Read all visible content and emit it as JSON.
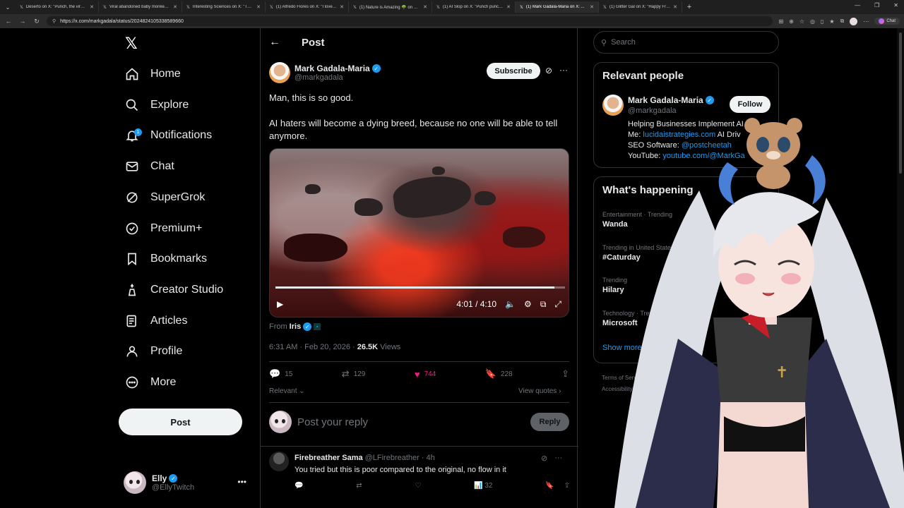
{
  "browser": {
    "tabs": [
      {
        "title": "Deserto on X: \"Punch, the viral toy...",
        "active": false
      },
      {
        "title": "Viral abandoned baby monkey tak...",
        "active": false
      },
      {
        "title": "Interesting Sciences on X: \"The sh...",
        "active": false
      },
      {
        "title": "(1) Alfredo Flores on X: \"I love pu...",
        "active": false
      },
      {
        "title": "(1) Nature is Amazing 🌳 on X: \"P...",
        "active": false
      },
      {
        "title": "(1) AI Slop on X: \"Punch punches t...",
        "active": false
      },
      {
        "title": "(1) Mark Gadala-Maria on X: ...",
        "active": true
      },
      {
        "title": "(1) Glitter Gal on X: \"Happy Friday...",
        "active": false
      }
    ],
    "url": "https://x.com/markgadala/status/2024824105338589660",
    "chat_label": "Chat"
  },
  "nav": {
    "items": [
      {
        "label": "Home",
        "icon": "home-icon"
      },
      {
        "label": "Explore",
        "icon": "search-icon"
      },
      {
        "label": "Notifications",
        "icon": "bell-icon"
      },
      {
        "label": "Chat",
        "icon": "mail-icon"
      },
      {
        "label": "SuperGrok",
        "icon": "grok-icon"
      },
      {
        "label": "Premium+",
        "icon": "premium-icon"
      },
      {
        "label": "Bookmarks",
        "icon": "bookmark-icon"
      },
      {
        "label": "Creator Studio",
        "icon": "creator-icon"
      },
      {
        "label": "Articles",
        "icon": "article-icon"
      },
      {
        "label": "Profile",
        "icon": "profile-icon"
      },
      {
        "label": "More",
        "icon": "more-circle-icon"
      }
    ],
    "notification_count": "1",
    "post_label": "Post",
    "account": {
      "name": "Elly",
      "handle": "@EllyTwitch"
    }
  },
  "post": {
    "header_title": "Post",
    "author_name": "Mark Gadala-Maria",
    "author_handle": "@markgadala",
    "subscribe_label": "Subscribe",
    "text1": "Man, this is so good.",
    "text2": "AI haters will become a dying breed, because no one will be able to tell anymore.",
    "video": {
      "time": "4:01 / 4:10",
      "progress": 0.964
    },
    "from_label": "From",
    "from_name": "Iris",
    "timestamp": "6:31 AM · Feb 20, 2026 · ",
    "views_count": "26.5K",
    "views_label": " Views",
    "replies": "15",
    "reposts": "129",
    "likes": "744",
    "bookmarks": "228",
    "relevant_label": "Relevant",
    "view_quotes_label": "View quotes",
    "reply_placeholder": "Post your reply",
    "reply_button": "Reply"
  },
  "reply": {
    "name": "Firebreather Sama",
    "handle": "@LFirebreather",
    "time": "· 4h",
    "text": "You tried but this is poor compared to the original, no flow in it",
    "views": "32"
  },
  "sidebar": {
    "search_placeholder": "Search",
    "relevant_title": "Relevant people",
    "person": {
      "name": "Mark Gadala-Maria",
      "handle": "@markgadala",
      "follow_label": "Follow",
      "bio_line1": "Helping Businesses Implement AI",
      "bio_line2_prefix": "Me: ",
      "bio_line2_link": "lucidaistrategies.com",
      "bio_line2_suffix": " AI Driv",
      "bio_line3_prefix": "SEO Software: ",
      "bio_line3_link": "@postcheetah",
      "bio_line4_prefix": "YouTube: ",
      "bio_line4_link": "youtube.com/@MarkGa"
    },
    "happening_title": "What's happening",
    "trends": [
      {
        "context": "Entertainment · Trending",
        "name": "Wanda"
      },
      {
        "context": "Trending in United States",
        "name": "#Caturday"
      },
      {
        "context": "Trending",
        "name": "Hilary"
      },
      {
        "context": "Technology · Trending",
        "name": "Microsoft"
      }
    ],
    "show_more": "Show more",
    "footer_line1": "Terms of Service",
    "footer_line2": "Accessibility"
  },
  "colors": {
    "accent": "#1d9bf0",
    "like": "#f91880",
    "background": "#000000"
  }
}
